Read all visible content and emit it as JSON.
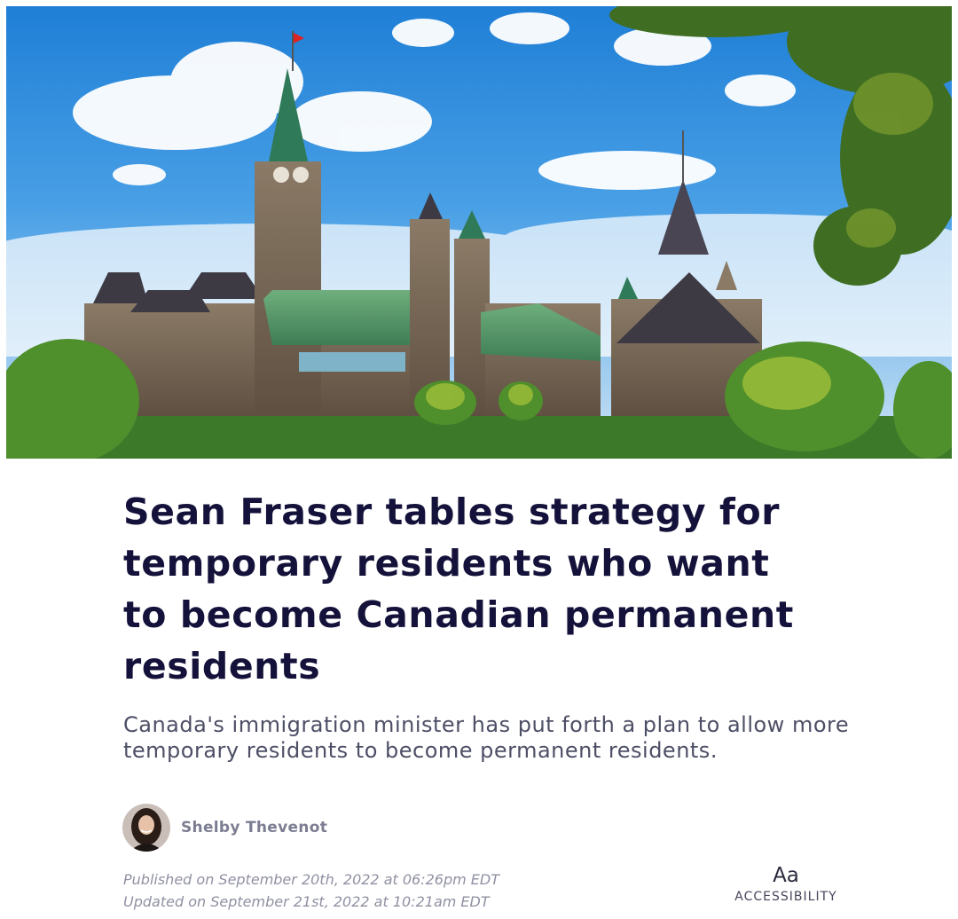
{
  "hero": {
    "alt": "Parliament Hill, Ottawa"
  },
  "article": {
    "headline": "Sean Fraser tables strategy for temporary residents who want to become Canadian permanent residents",
    "subheadline": "Canada's immigration minister has put forth a plan to allow more temporary residents to become permanent residents.",
    "author": {
      "name": "Shelby Thevenot",
      "avatar_icon": "author-photo"
    },
    "published": "Published on September 20th, 2022 at 06:26pm EDT",
    "updated": "Updated on September 21st, 2022 at 10:21am EDT"
  },
  "accessibility": {
    "icon_text": "Aa",
    "label": "ACCESSIBILITY"
  },
  "colors": {
    "headline": "#14123a",
    "subheadline": "#4d4f66",
    "meta": "#8f91a2"
  }
}
